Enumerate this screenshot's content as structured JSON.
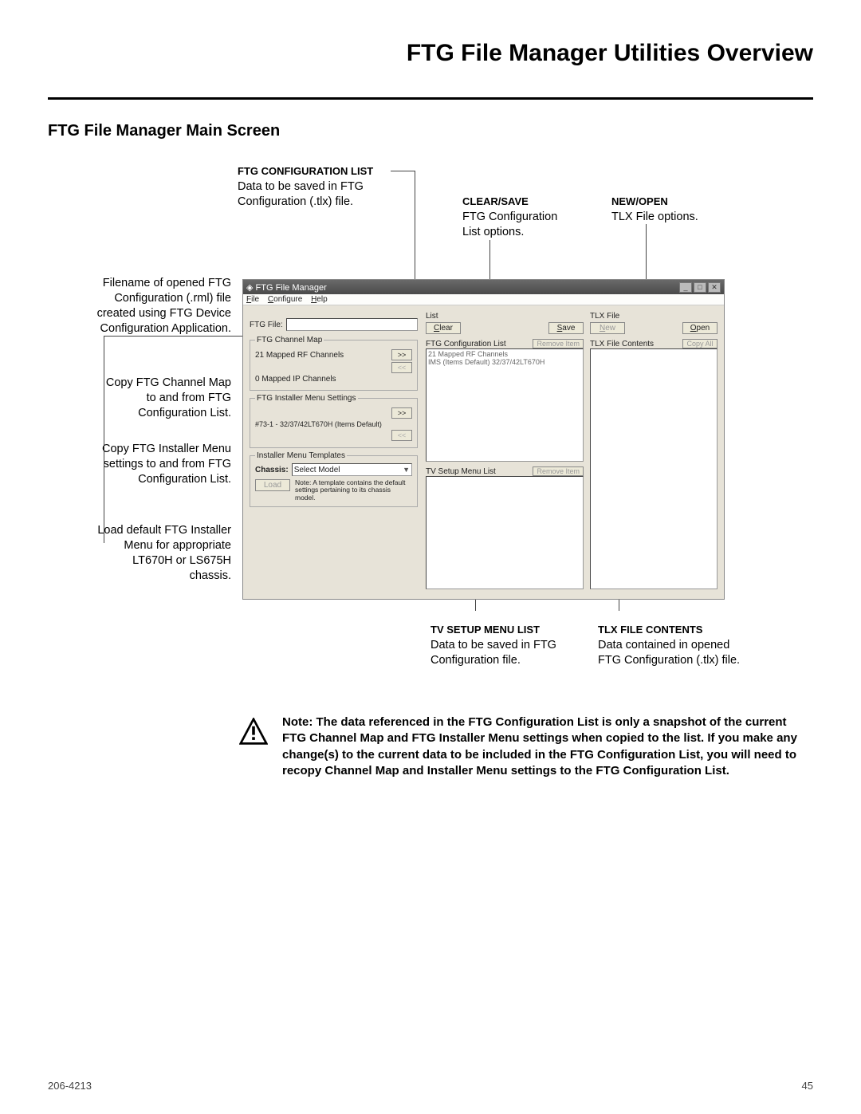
{
  "page": {
    "title": "FTG File Manager Utilities Overview",
    "section": "FTG File Manager Main Screen",
    "doc_number": "206-4213",
    "page_number": "45"
  },
  "annotations": {
    "config_list": {
      "label": "FTG CONFIGURATION LIST",
      "desc1": "Data to be saved in FTG",
      "desc2": "Configuration (.tlx) file."
    },
    "clear_save": {
      "label": "CLEAR/SAVE",
      "desc1": "FTG Configuration",
      "desc2": "List options."
    },
    "new_open": {
      "label": "NEW/OPEN",
      "desc1": "TLX File options."
    },
    "filename": {
      "line1": "Filename of opened FTG",
      "line2": "Configuration (.rml) file",
      "line3": "created using FTG Device",
      "line4": "Configuration Application."
    },
    "chanmap": {
      "line1": "Copy FTG Channel Map",
      "line2": "to and from FTG",
      "line3": "Configuration List."
    },
    "installer": {
      "line1": "Copy FTG Installer Menu",
      "line2": "settings to and from FTG",
      "line3": "Configuration List."
    },
    "load_def": {
      "line1": "Load default FTG Installer",
      "line2": "Menu for appropriate",
      "line3": "LT670H or LS675H",
      "line4": "chassis."
    },
    "tv_setup": {
      "label": "TV SETUP MENU LIST",
      "desc1": "Data to be saved in FTG",
      "desc2": "Configuration file."
    },
    "tlx_contents": {
      "label": "TLX FILE CONTENTS",
      "desc1": "Data contained in opened",
      "desc2": "FTG Configuration (.tlx) file."
    }
  },
  "app": {
    "title": "FTG File Manager",
    "menu": {
      "file": "File",
      "configure": "Configure",
      "help": "Help"
    },
    "ftg_file_label": "FTG File:",
    "list_label": "List",
    "tlx_file_label": "TLX File",
    "btn_clear": "Clear",
    "btn_save": "Save",
    "btn_new": "New",
    "btn_open": "Open",
    "ftg_config_list_label": "FTG Configuration List",
    "remove_item": "Remove Item",
    "tlx_file_contents_label": "TLX File Contents",
    "copy_all": "Copy All",
    "channel_map_legend": "FTG Channel Map",
    "rf_channels": "21 Mapped RF Channels",
    "ip_channels": "0 Mapped IP Channels",
    "installer_legend": "FTG Installer Menu Settings",
    "installer_line": "#73-1 - 32/37/42LT670H (Items Default)",
    "templates_legend": "Installer Menu Templates",
    "chassis_label": "Chassis:",
    "select_model": "Select Model",
    "load_btn": "Load",
    "template_note": "Note: A template contains the default settings pertaining to its chassis model.",
    "tv_setup_label": "TV Setup Menu List",
    "list_line1": "21 Mapped RF Channels",
    "list_line2": "IMS (Items Default) 32/37/42LT670H"
  },
  "note": "Note: The data referenced in the FTG Configuration List is only a snapshot of the current FTG Channel Map and FTG Installer Menu settings when copied to the list. If you make any change(s) to the current data to be included in the FTG Configuration List, you will need to recopy Channel Map and Installer Menu settings to the FTG Configuration List."
}
